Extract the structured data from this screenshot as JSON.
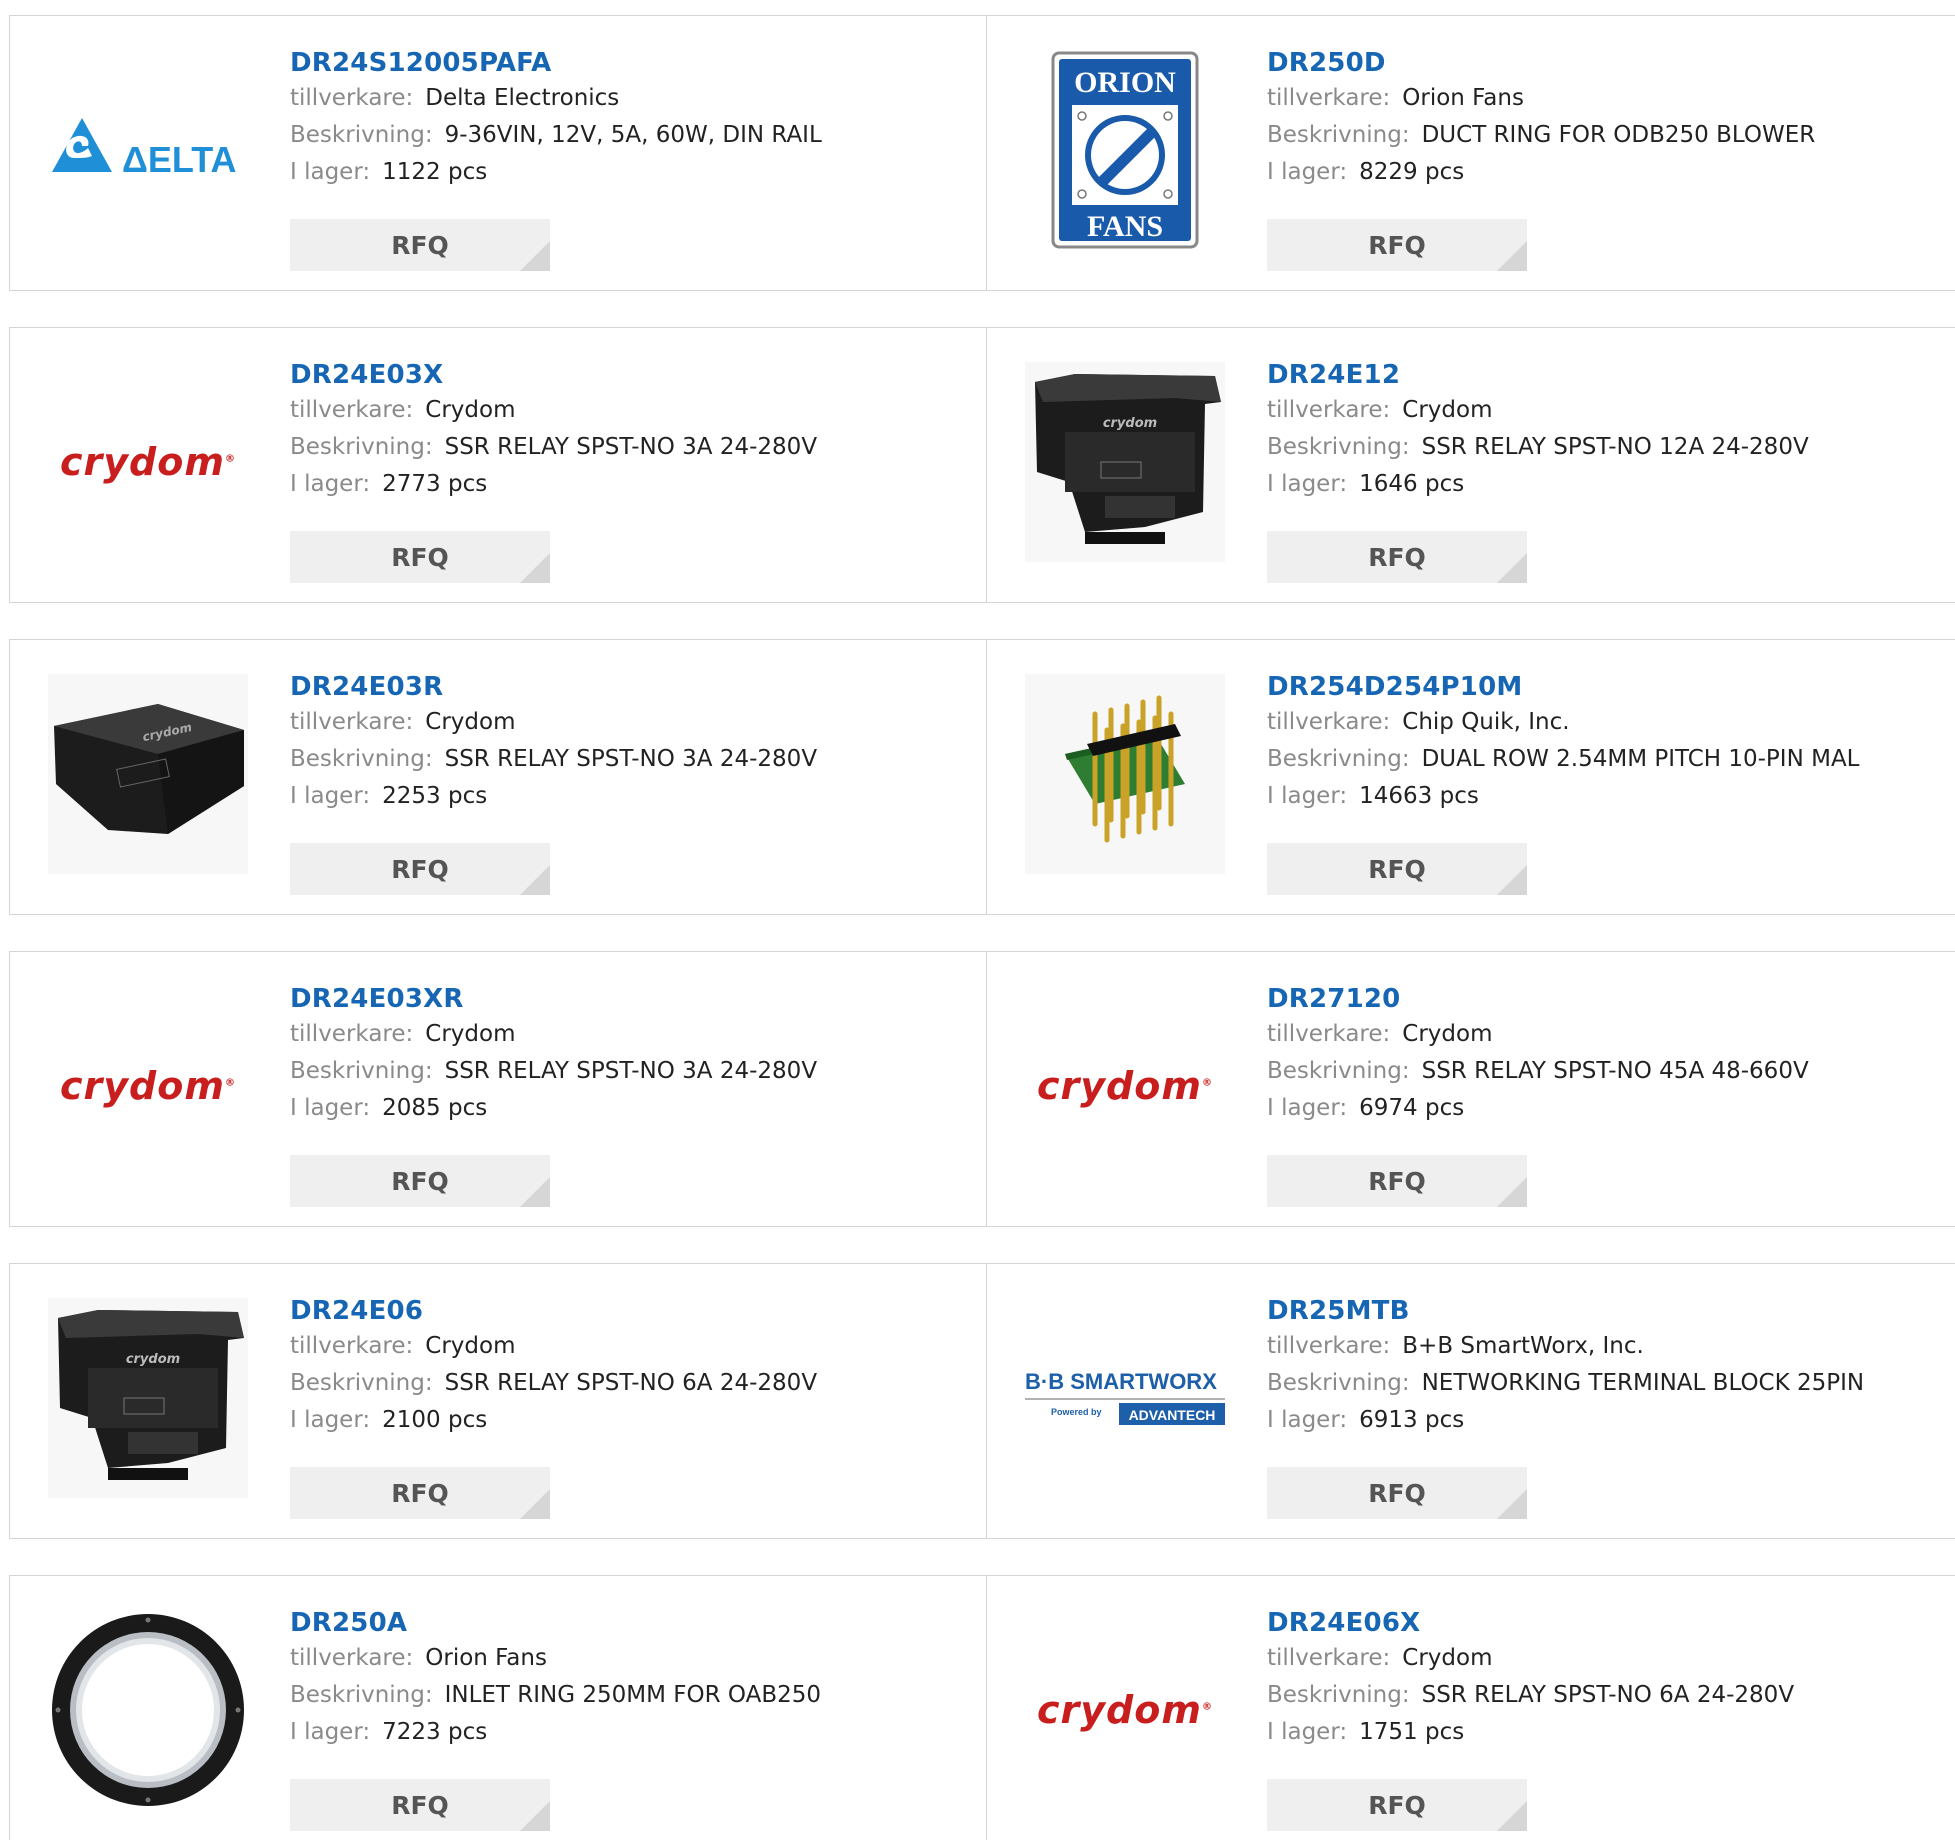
{
  "labels": {
    "manufacturer": "tillverkare:",
    "description": "Beskrivning:",
    "stock": "I lager:",
    "rfq": "RFQ"
  },
  "colors": {
    "part_link": "#1666b3",
    "crydom_red": "#c81e1e",
    "delta_blue": "#1f8fd8",
    "orion_blue": "#1a5aab"
  },
  "logos": {
    "delta": "ΔELTA",
    "orion_top": "ORION",
    "orion_bottom": "FANS",
    "crydom": "crydom",
    "bb": "B·B SMARTWORX",
    "bb_powered": "Powered by",
    "bb_advantech": "ADVANTECH"
  },
  "products": [
    {
      "part": "DR24S12005PAFA",
      "manufacturer": "Delta Electronics",
      "description": "9-36VIN, 12V, 5A, 60W, DIN RAIL",
      "stock": "1122 pcs",
      "image": "delta-logo"
    },
    {
      "part": "DR250D",
      "manufacturer": "Orion Fans",
      "description": "DUCT RING FOR ODB250 BLOWER",
      "stock": "8229 pcs",
      "image": "orion-fans-logo"
    },
    {
      "part": "DR24E03X",
      "manufacturer": "Crydom",
      "description": "SSR RELAY SPST-NO 3A 24-280V",
      "stock": "2773 pcs",
      "image": "crydom-logo"
    },
    {
      "part": "DR24E12",
      "manufacturer": "Crydom",
      "description": "SSR RELAY SPST-NO 12A 24-280V",
      "stock": "1646 pcs",
      "image": "relay-photo"
    },
    {
      "part": "DR24E03R",
      "manufacturer": "Crydom",
      "description": "SSR RELAY SPST-NO 3A 24-280V",
      "stock": "2253 pcs",
      "image": "relay-photo-angled"
    },
    {
      "part": "DR254D254P10M",
      "manufacturer": "Chip Quik, Inc.",
      "description": "DUAL ROW 2.54MM PITCH 10-PIN MAL",
      "stock": "14663 pcs",
      "image": "pin-header-photo"
    },
    {
      "part": "DR24E03XR",
      "manufacturer": "Crydom",
      "description": "SSR RELAY SPST-NO 3A 24-280V",
      "stock": "2085 pcs",
      "image": "crydom-logo"
    },
    {
      "part": "DR27120",
      "manufacturer": "Crydom",
      "description": "SSR RELAY SPST-NO 45A 48-660V",
      "stock": "6974 pcs",
      "image": "crydom-logo"
    },
    {
      "part": "DR24E06",
      "manufacturer": "Crydom",
      "description": "SSR RELAY SPST-NO 6A 24-280V",
      "stock": "2100 pcs",
      "image": "relay-photo"
    },
    {
      "part": "DR25MTB",
      "manufacturer": "B+B SmartWorx, Inc.",
      "description": "NETWORKING TERMINAL BLOCK 25PIN",
      "stock": "6913 pcs",
      "image": "bb-smartworx-logo"
    },
    {
      "part": "DR250A",
      "manufacturer": "Orion Fans",
      "description": "INLET RING 250MM FOR OAB250",
      "stock": "7223 pcs",
      "image": "inlet-ring-photo"
    },
    {
      "part": "DR24E06X",
      "manufacturer": "Crydom",
      "description": "SSR RELAY SPST-NO 6A 24-280V",
      "stock": "1751 pcs",
      "image": "crydom-logo"
    }
  ]
}
